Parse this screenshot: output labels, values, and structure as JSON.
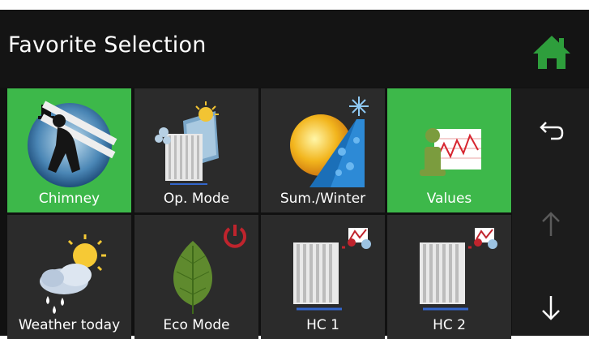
{
  "header": {
    "title": "Favorite Selection"
  },
  "tiles": [
    {
      "label": "Chimney",
      "active": true,
      "icon": "chimney-sweep-icon"
    },
    {
      "label": "Op. Mode",
      "active": false,
      "icon": "operating-mode-icon"
    },
    {
      "label": "Sum./Winter",
      "active": false,
      "icon": "summer-winter-icon"
    },
    {
      "label": "Values",
      "active": true,
      "icon": "values-info-icon"
    },
    {
      "label": "Weather today",
      "active": false,
      "icon": "weather-icon"
    },
    {
      "label": "Eco Mode",
      "active": false,
      "icon": "eco-leaf-icon"
    },
    {
      "label": "HC 1",
      "active": false,
      "icon": "heating-circuit-icon"
    },
    {
      "label": "HC 2",
      "active": false,
      "icon": "heating-circuit-icon"
    }
  ],
  "side_nav": {
    "home": "home-icon",
    "back": "back-icon",
    "up": "arrow-up-icon",
    "down": "arrow-down-icon"
  },
  "colors": {
    "active_tile": "#3db84a",
    "tile": "#2b2b2b",
    "home": "#2e9e3c",
    "power": "#c0242d"
  }
}
